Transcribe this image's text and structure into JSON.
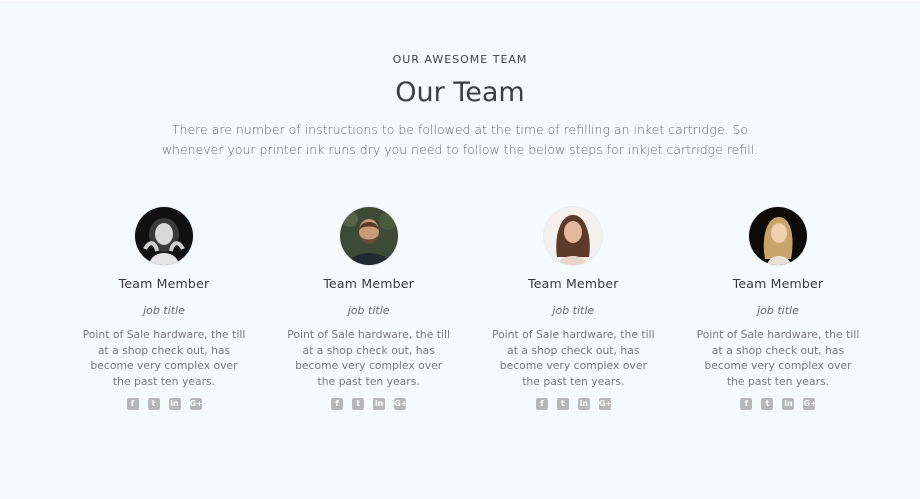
{
  "header": {
    "kicker": "OUR AWESOME TEAM",
    "title": "Our Team",
    "intro": "There are number of instructions to be followed at the time of refilling an inket cartridge. So whenever your printer ink runs dry you need to follow the below steps for inkjet cartridge refill."
  },
  "members": [
    {
      "name": "Team Member",
      "job_title": "job title",
      "description": "Point of Sale hardware, the till at a shop check out, has become very complex over the past ten years.",
      "avatar_icon": "woman-bw-portrait-icon"
    },
    {
      "name": "Team Member",
      "job_title": "job title",
      "description": "Point of Sale hardware, the till at a shop check out, has become very complex over the past ten years.",
      "avatar_icon": "bearded-man-portrait-icon"
    },
    {
      "name": "Team Member",
      "job_title": "job title",
      "description": "Point of Sale hardware, the till at a shop check out, has become very complex over the past ten years.",
      "avatar_icon": "brunette-woman-portrait-icon"
    },
    {
      "name": "Team Member",
      "job_title": "job title",
      "description": "Point of Sale hardware, the till at a shop check out, has become very complex over the past ten years.",
      "avatar_icon": "blonde-woman-portrait-icon"
    }
  ],
  "social_icons": [
    {
      "name": "facebook-icon",
      "glyph": "f"
    },
    {
      "name": "twitter-icon",
      "glyph": "t"
    },
    {
      "name": "linkedin-icon",
      "glyph": "in"
    },
    {
      "name": "google-plus-icon",
      "glyph": "G+"
    }
  ],
  "colors": {
    "background": "#f5fafc",
    "social_icon": "#b7b7b7",
    "heading": "#3b3f46"
  }
}
